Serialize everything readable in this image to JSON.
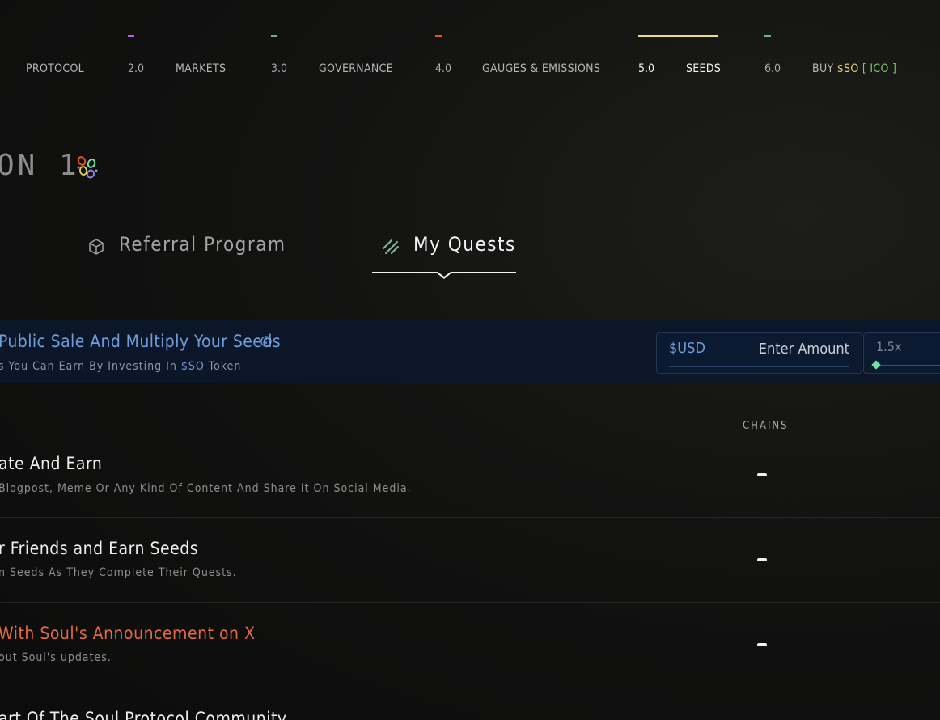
{
  "nav": {
    "items": [
      {
        "label": "PROTOCOL"
      },
      {
        "num": "2.0",
        "label": "MARKETS"
      },
      {
        "num": "3.0",
        "label": "GOVERNANCE"
      },
      {
        "num": "4.0",
        "label": "GAUGES & EMISSIONS"
      },
      {
        "num": "5.0",
        "label": "SEEDS"
      },
      {
        "num": "6.0",
        "label_prefix": "BUY",
        "label_token": "$SO",
        "label_suffix": "[ ICO ]"
      }
    ],
    "marker_colors": [
      "#c05ad6",
      "#6fb07a",
      "#e0552f",
      "#e9e07a",
      "#5dbf7d"
    ]
  },
  "season": {
    "title": "ON 1"
  },
  "tabs": {
    "referral": "Referral Program",
    "quests": "My Quests"
  },
  "banner": {
    "title": "Public Sale And Multiply Your Seeds",
    "subtitle_prefix": "s You Can Earn By Investing In",
    "subtitle_token": "$SO",
    "subtitle_suffix": "Token",
    "currency": "$USD",
    "amount_placeholder": "Enter Amount",
    "multiplier": "1.5x",
    "multiplier_fraction": 0
  },
  "table": {
    "chains_header": "CHAINS",
    "rows": [
      {
        "title": "ate And Earn",
        "desc": "Blogpost, Meme Or Any Kind Of Content And Share It On Social Media.",
        "chain": "–"
      },
      {
        "title": "r Friends and Earn Seeds",
        "desc": "n Seeds As They Complete Their Quests.",
        "chain": "–"
      },
      {
        "title": "With Soul's Announcement on X",
        "desc": "out Soul's updates.",
        "chain": "–"
      },
      {
        "title": "art Of The Soul Protocol Community",
        "desc": "",
        "chain": ""
      }
    ]
  },
  "colors": {
    "accent_blue": "#6f9ddc",
    "gold": "#e6d26b",
    "green": "#7cc36a",
    "orange": "#e36a43",
    "banner_bg": "#0b1629"
  }
}
